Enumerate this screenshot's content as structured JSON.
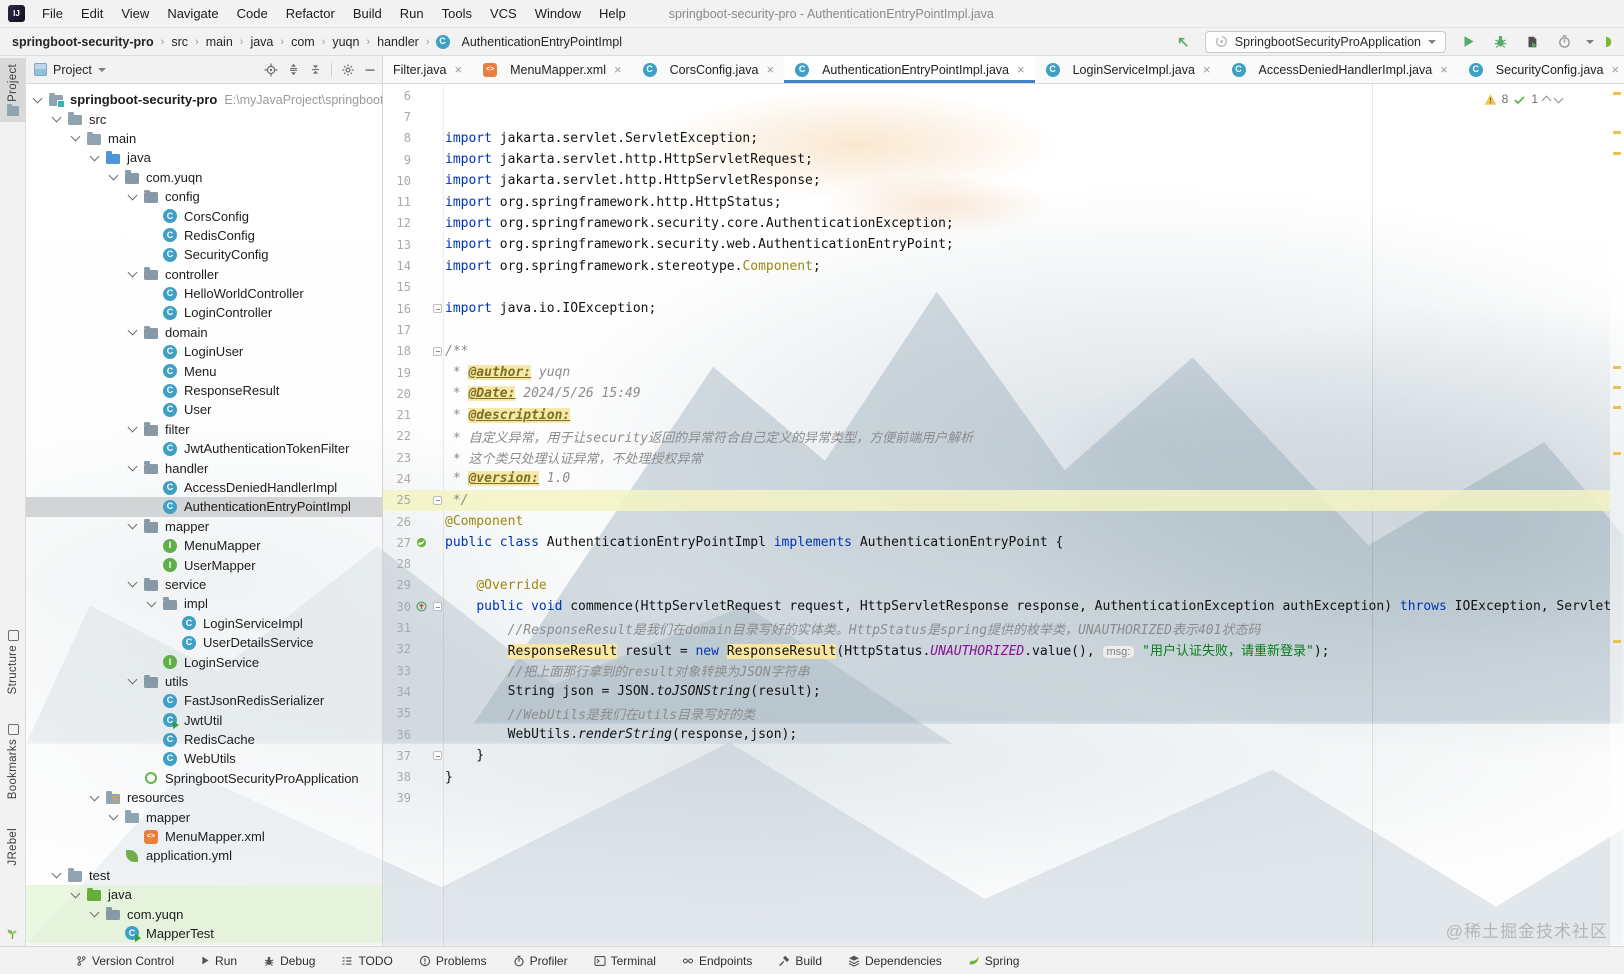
{
  "titlebar": {
    "title": "springboot-security-pro - AuthenticationEntryPointImpl.java"
  },
  "menu": {
    "items": [
      "File",
      "Edit",
      "View",
      "Navigate",
      "Code",
      "Refactor",
      "Build",
      "Run",
      "Tools",
      "VCS",
      "Window",
      "Help"
    ]
  },
  "breadcrumbs": {
    "items": [
      "springboot-security-pro",
      "src",
      "main",
      "java",
      "com",
      "yuqn",
      "handler"
    ],
    "class_item": "AuthenticationEntryPointImpl"
  },
  "runbar": {
    "config_name": "SpringbootSecurityProApplication",
    "left_icons": [
      "build-arrow"
    ],
    "right_icons": [
      "run",
      "debug",
      "coverage",
      "profiler",
      "more-caret",
      "jrebel-edge"
    ]
  },
  "project": {
    "header": {
      "title": "Project",
      "icons": [
        "locate",
        "expand-all",
        "collapse-all",
        "settings",
        "hide"
      ]
    },
    "tree": [
      {
        "d": 0,
        "i": "root",
        "l": "springboot-security-pro",
        "path": "E:\\myJavaProject\\springboot-",
        "chev": true,
        "bold": true
      },
      {
        "d": 1,
        "i": "folder",
        "l": "src",
        "chev": true
      },
      {
        "d": 2,
        "i": "folder",
        "l": "main",
        "chev": true
      },
      {
        "d": 3,
        "i": "srcjava",
        "l": "java",
        "chev": true
      },
      {
        "d": 4,
        "i": "pkg",
        "l": "com.yuqn",
        "chev": true
      },
      {
        "d": 5,
        "i": "pkg",
        "l": "config",
        "chev": true
      },
      {
        "d": 6,
        "i": "class",
        "l": "CorsConfig"
      },
      {
        "d": 6,
        "i": "class",
        "l": "RedisConfig"
      },
      {
        "d": 6,
        "i": "class",
        "l": "SecurityConfig"
      },
      {
        "d": 5,
        "i": "pkg",
        "l": "controller",
        "chev": true
      },
      {
        "d": 6,
        "i": "class",
        "l": "HelloWorldController"
      },
      {
        "d": 6,
        "i": "class",
        "l": "LoginController"
      },
      {
        "d": 5,
        "i": "pkg",
        "l": "domain",
        "chev": true
      },
      {
        "d": 6,
        "i": "class",
        "l": "LoginUser"
      },
      {
        "d": 6,
        "i": "class",
        "l": "Menu"
      },
      {
        "d": 6,
        "i": "class",
        "l": "ResponseResult"
      },
      {
        "d": 6,
        "i": "class",
        "l": "User"
      },
      {
        "d": 5,
        "i": "pkg",
        "l": "filter",
        "chev": true
      },
      {
        "d": 6,
        "i": "class",
        "l": "JwtAuthenticationTokenFilter"
      },
      {
        "d": 5,
        "i": "pkg",
        "l": "handler",
        "chev": true
      },
      {
        "d": 6,
        "i": "class",
        "l": "AccessDeniedHandlerImpl"
      },
      {
        "d": 6,
        "i": "class",
        "l": "AuthenticationEntryPointImpl",
        "sel": true
      },
      {
        "d": 5,
        "i": "pkg",
        "l": "mapper",
        "chev": true
      },
      {
        "d": 6,
        "i": "iface",
        "l": "MenuMapper"
      },
      {
        "d": 6,
        "i": "iface",
        "l": "UserMapper"
      },
      {
        "d": 5,
        "i": "pkg",
        "l": "service",
        "chev": true
      },
      {
        "d": 6,
        "i": "pkg",
        "l": "impl",
        "chev": true
      },
      {
        "d": 7,
        "i": "class",
        "l": "LoginServiceImpl"
      },
      {
        "d": 7,
        "i": "class",
        "l": "UserDetailsService"
      },
      {
        "d": 6,
        "i": "iface",
        "l": "LoginService"
      },
      {
        "d": 5,
        "i": "pkg",
        "l": "utils",
        "chev": true
      },
      {
        "d": 6,
        "i": "class",
        "l": "FastJsonRedisSerializer"
      },
      {
        "d": 6,
        "i": "classrun",
        "l": "JwtUtil"
      },
      {
        "d": 6,
        "i": "class",
        "l": "RedisCache"
      },
      {
        "d": 6,
        "i": "class",
        "l": "WebUtils"
      },
      {
        "d": 5,
        "i": "boot",
        "l": "SpringbootSecurityProApplication"
      },
      {
        "d": 3,
        "i": "res",
        "l": "resources",
        "chev": true
      },
      {
        "d": 4,
        "i": "folder",
        "l": "mapper",
        "chev": true
      },
      {
        "d": 5,
        "i": "xml",
        "l": "MenuMapper.xml"
      },
      {
        "d": 4,
        "i": "yml",
        "l": "application.yml"
      },
      {
        "d": 1,
        "i": "folder",
        "l": "test",
        "chev": true
      },
      {
        "d": 2,
        "i": "testjava",
        "l": "java",
        "chev": true,
        "green": true
      },
      {
        "d": 3,
        "i": "pkg",
        "l": "com.yuqn",
        "chev": true,
        "green": true
      },
      {
        "d": 4,
        "i": "classrun",
        "l": "MapperTest",
        "green": true
      }
    ]
  },
  "tabs": {
    "items": [
      {
        "label": "Filter.java",
        "icon": "none",
        "active": false
      },
      {
        "label": "MenuMapper.xml",
        "icon": "xml",
        "active": false
      },
      {
        "label": "CorsConfig.java",
        "icon": "class",
        "active": false
      },
      {
        "label": "AuthenticationEntryPointImpl.java",
        "icon": "class",
        "active": true
      },
      {
        "label": "LoginServiceImpl.java",
        "icon": "class",
        "active": false
      },
      {
        "label": "AccessDeniedHandlerImpl.java",
        "icon": "class",
        "active": false
      },
      {
        "label": "SecurityConfig.java",
        "icon": "class",
        "active": false
      }
    ]
  },
  "editor": {
    "inspections": {
      "warnings": "8",
      "passed": "1"
    },
    "stripe_marks": [
      8,
      47,
      68,
      282,
      302,
      322,
      368,
      556
    ],
    "lines": [
      {
        "n": 6
      },
      {
        "n": 7
      },
      {
        "n": 8,
        "t": [
          [
            "kw",
            "import "
          ],
          [
            "pl",
            "jakarta.servlet.ServletException;"
          ]
        ]
      },
      {
        "n": 9,
        "t": [
          [
            "kw",
            "import "
          ],
          [
            "pl",
            "jakarta.servlet.http.HttpServletRequest;"
          ]
        ]
      },
      {
        "n": 10,
        "t": [
          [
            "kw",
            "import "
          ],
          [
            "pl",
            "jakarta.servlet.http.HttpServletResponse;"
          ]
        ]
      },
      {
        "n": 11,
        "t": [
          [
            "kw",
            "import "
          ],
          [
            "pl",
            "org.springframework.http.HttpStatus;"
          ]
        ]
      },
      {
        "n": 12,
        "t": [
          [
            "kw",
            "import "
          ],
          [
            "pl",
            "org.springframework.security.core.AuthenticationException;"
          ]
        ]
      },
      {
        "n": 13,
        "t": [
          [
            "kw",
            "import "
          ],
          [
            "pl",
            "org.springframework.security.web.AuthenticationEntryPoint;"
          ]
        ]
      },
      {
        "n": 14,
        "t": [
          [
            "kw",
            "import "
          ],
          [
            "pl",
            "org.springframework.stereotype."
          ],
          [
            "ann",
            "Component"
          ],
          [
            "pl",
            ";"
          ]
        ]
      },
      {
        "n": 15
      },
      {
        "n": 16,
        "fold": "open",
        "t": [
          [
            "kw",
            "import "
          ],
          [
            "pl",
            "java.io.IOException;"
          ]
        ]
      },
      {
        "n": 17
      },
      {
        "n": 18,
        "fold": "open",
        "t": [
          [
            "doc",
            "/**"
          ]
        ]
      },
      {
        "n": 19,
        "t": [
          [
            "doc",
            " * "
          ],
          [
            "dt",
            "@author:"
          ],
          [
            "doc",
            " yuqn"
          ]
        ]
      },
      {
        "n": 20,
        "t": [
          [
            "doc",
            " * "
          ],
          [
            "dt",
            "@Date:"
          ],
          [
            "doc",
            " 2024/5/26 15:49"
          ]
        ]
      },
      {
        "n": 21,
        "t": [
          [
            "doc",
            " * "
          ],
          [
            "dt",
            "@description:"
          ]
        ]
      },
      {
        "n": 22,
        "t": [
          [
            "doc",
            " * 自定义异常，用于让security返回的异常符合自己定义的异常类型，方便前端用户解析"
          ]
        ]
      },
      {
        "n": 23,
        "t": [
          [
            "doc",
            " * 这个类只处理认证异常，不处理授权异常"
          ]
        ]
      },
      {
        "n": 24,
        "t": [
          [
            "doc",
            " * "
          ],
          [
            "dt",
            "@version:"
          ],
          [
            "doc",
            " 1.0"
          ]
        ]
      },
      {
        "n": 25,
        "caret": true,
        "fold": "close",
        "t": [
          [
            "doc",
            " */"
          ]
        ]
      },
      {
        "n": 26,
        "t": [
          [
            "ann",
            "@Component"
          ]
        ]
      },
      {
        "n": 27,
        "gicon": "spring-bean",
        "t": [
          [
            "kw",
            "public class "
          ],
          [
            "pl",
            "AuthenticationEntryPointImpl "
          ],
          [
            "kw",
            "implements "
          ],
          [
            "pl",
            "AuthenticationEntryPoint {"
          ]
        ]
      },
      {
        "n": 28
      },
      {
        "n": 29,
        "t": [
          [
            "pl",
            "    "
          ],
          [
            "ann",
            "@Override"
          ]
        ]
      },
      {
        "n": 30,
        "gicon": "override",
        "fold": "open",
        "t": [
          [
            "pl",
            "    "
          ],
          [
            "kw",
            "public void "
          ],
          [
            "pl",
            "commence(HttpServletRequest request, HttpServletResponse response, AuthenticationException authException) "
          ],
          [
            "kw",
            "throws "
          ],
          [
            "pl",
            "IOException, ServletException {"
          ]
        ]
      },
      {
        "n": 31,
        "t": [
          [
            "pl",
            "        "
          ],
          [
            "cmt",
            "//ResponseResult是我们在domain目录写好的实体类。HttpStatus是spring提供的枚举类，UNAUTHORIZED表示401状态码"
          ]
        ]
      },
      {
        "n": 32,
        "t": [
          [
            "pl",
            "        "
          ],
          [
            "hl",
            "ResponseResult"
          ],
          [
            "pl",
            " result = "
          ],
          [
            "kw",
            "new "
          ],
          [
            "hl",
            "ResponseResult"
          ],
          [
            "pl",
            "(HttpStatus."
          ],
          [
            "st",
            "UNAUTHORIZED"
          ],
          [
            "pl",
            ".value(), "
          ],
          [
            "hint",
            "msg:"
          ],
          [
            "pl",
            " "
          ],
          [
            "str",
            "\"用户认证失败，请重新登录\""
          ],
          [
            "pl",
            ");"
          ]
        ]
      },
      {
        "n": 33,
        "t": [
          [
            "pl",
            "        "
          ],
          [
            "cmt",
            "//把上面那行拿到的result对象转换为JSON字符串"
          ]
        ]
      },
      {
        "n": 34,
        "t": [
          [
            "pl",
            "        String json = JSON."
          ],
          [
            "itl",
            "toJSONString"
          ],
          [
            "pl",
            "(result);"
          ]
        ]
      },
      {
        "n": 35,
        "t": [
          [
            "pl",
            "        "
          ],
          [
            "cmt",
            "//WebUtils是我们在utils目录写好的类"
          ]
        ]
      },
      {
        "n": 36,
        "t": [
          [
            "pl",
            "        WebUtils."
          ],
          [
            "itl",
            "renderString"
          ],
          [
            "pl",
            "(response,json);"
          ]
        ]
      },
      {
        "n": 37,
        "fold": "close",
        "t": [
          [
            "pl",
            "    }"
          ]
        ]
      },
      {
        "n": 38,
        "t": [
          [
            "pl",
            "}"
          ]
        ]
      },
      {
        "n": 39
      }
    ]
  },
  "statusbar": {
    "items": [
      {
        "label": "Version Control",
        "icon": "branch"
      },
      {
        "label": "Run",
        "icon": "play"
      },
      {
        "label": "Debug",
        "icon": "bug"
      },
      {
        "label": "TODO",
        "icon": "todo"
      },
      {
        "label": "Problems",
        "icon": "problems"
      },
      {
        "label": "Profiler",
        "icon": "profiler"
      },
      {
        "label": "Terminal",
        "icon": "terminal"
      },
      {
        "label": "Endpoints",
        "icon": "endpoints"
      },
      {
        "label": "Build",
        "icon": "build"
      },
      {
        "label": "Dependencies",
        "icon": "deps"
      },
      {
        "label": "Spring",
        "icon": "spring"
      }
    ]
  },
  "stripes": {
    "top": [
      "Project"
    ],
    "bottom": [
      "Structure",
      "Bookmarks",
      "JRebel"
    ]
  },
  "watermark": "@稀土掘金技术社区"
}
